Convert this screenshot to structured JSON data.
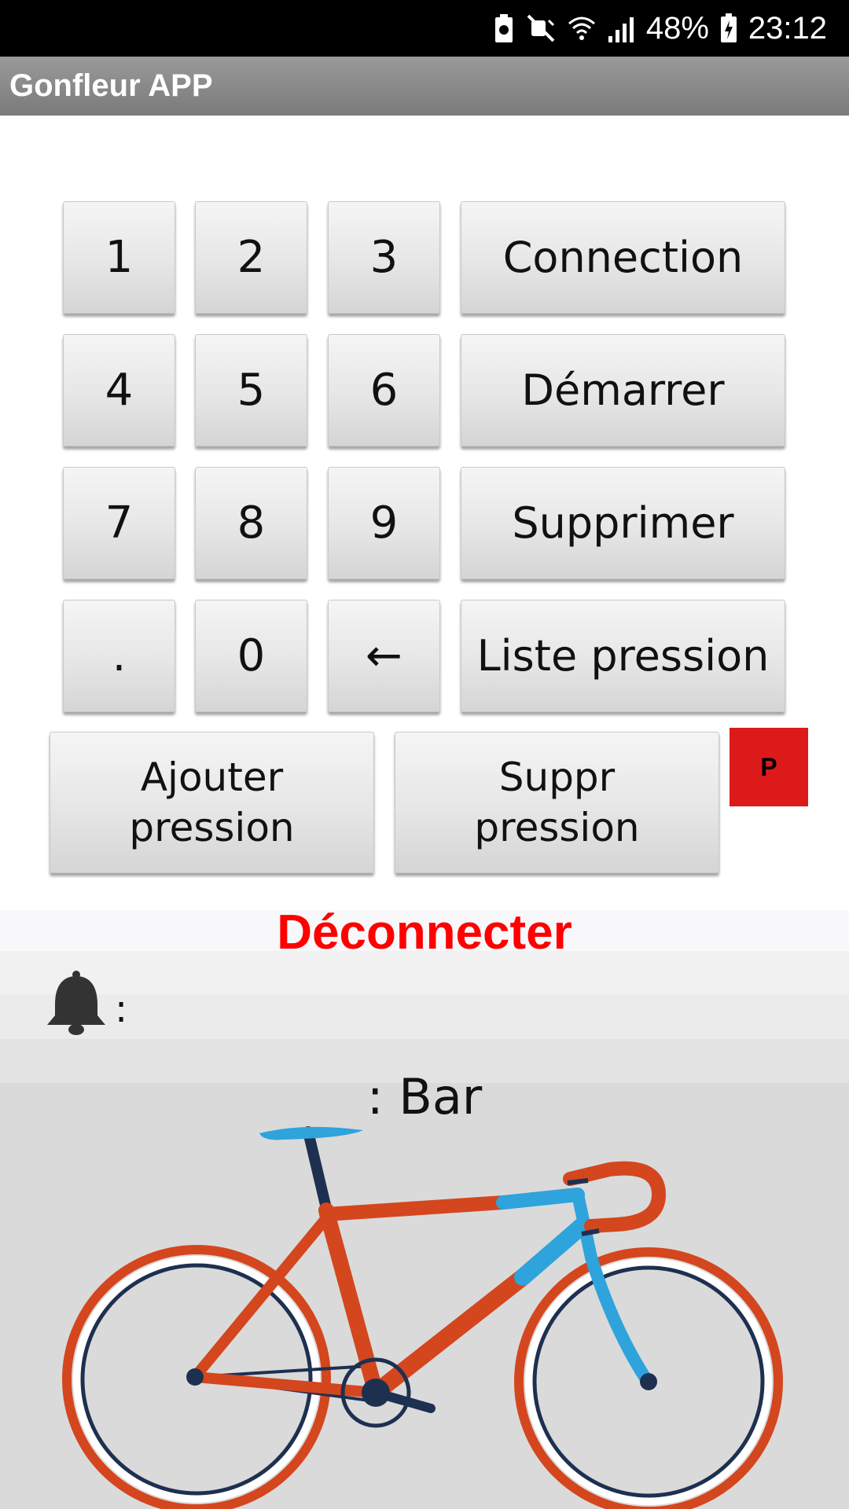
{
  "status_bar": {
    "battery_percent": "48%",
    "time": "23:12",
    "icons": [
      "battery-saver-icon",
      "mute-icon",
      "wifi-icon",
      "signal-icon",
      "battery-charging-icon"
    ]
  },
  "app": {
    "title": "Gonfleur APP"
  },
  "keypad": {
    "keys": [
      "1",
      "2",
      "3",
      "4",
      "5",
      "6",
      "7",
      "8",
      "9",
      ".",
      "0",
      "←"
    ]
  },
  "actions": {
    "connection": "Connection",
    "start": "Démarrer",
    "delete": "Supprimer",
    "pressure_list": "Liste pression",
    "add_pressure_line1": "Ajouter",
    "add_pressure_line2": "pression",
    "remove_pressure_line1": "Suppr",
    "remove_pressure_line2": "pression",
    "p_badge": "P"
  },
  "status": {
    "disconnect": "Déconnecter",
    "alert_colon": ":",
    "pressure_unit_label": ": Bar"
  },
  "colors": {
    "accent_red": "#ff0000",
    "badge_red": "#dd1a1a",
    "bike_frame": "#d4461e",
    "bike_blue": "#2fa3dc"
  }
}
